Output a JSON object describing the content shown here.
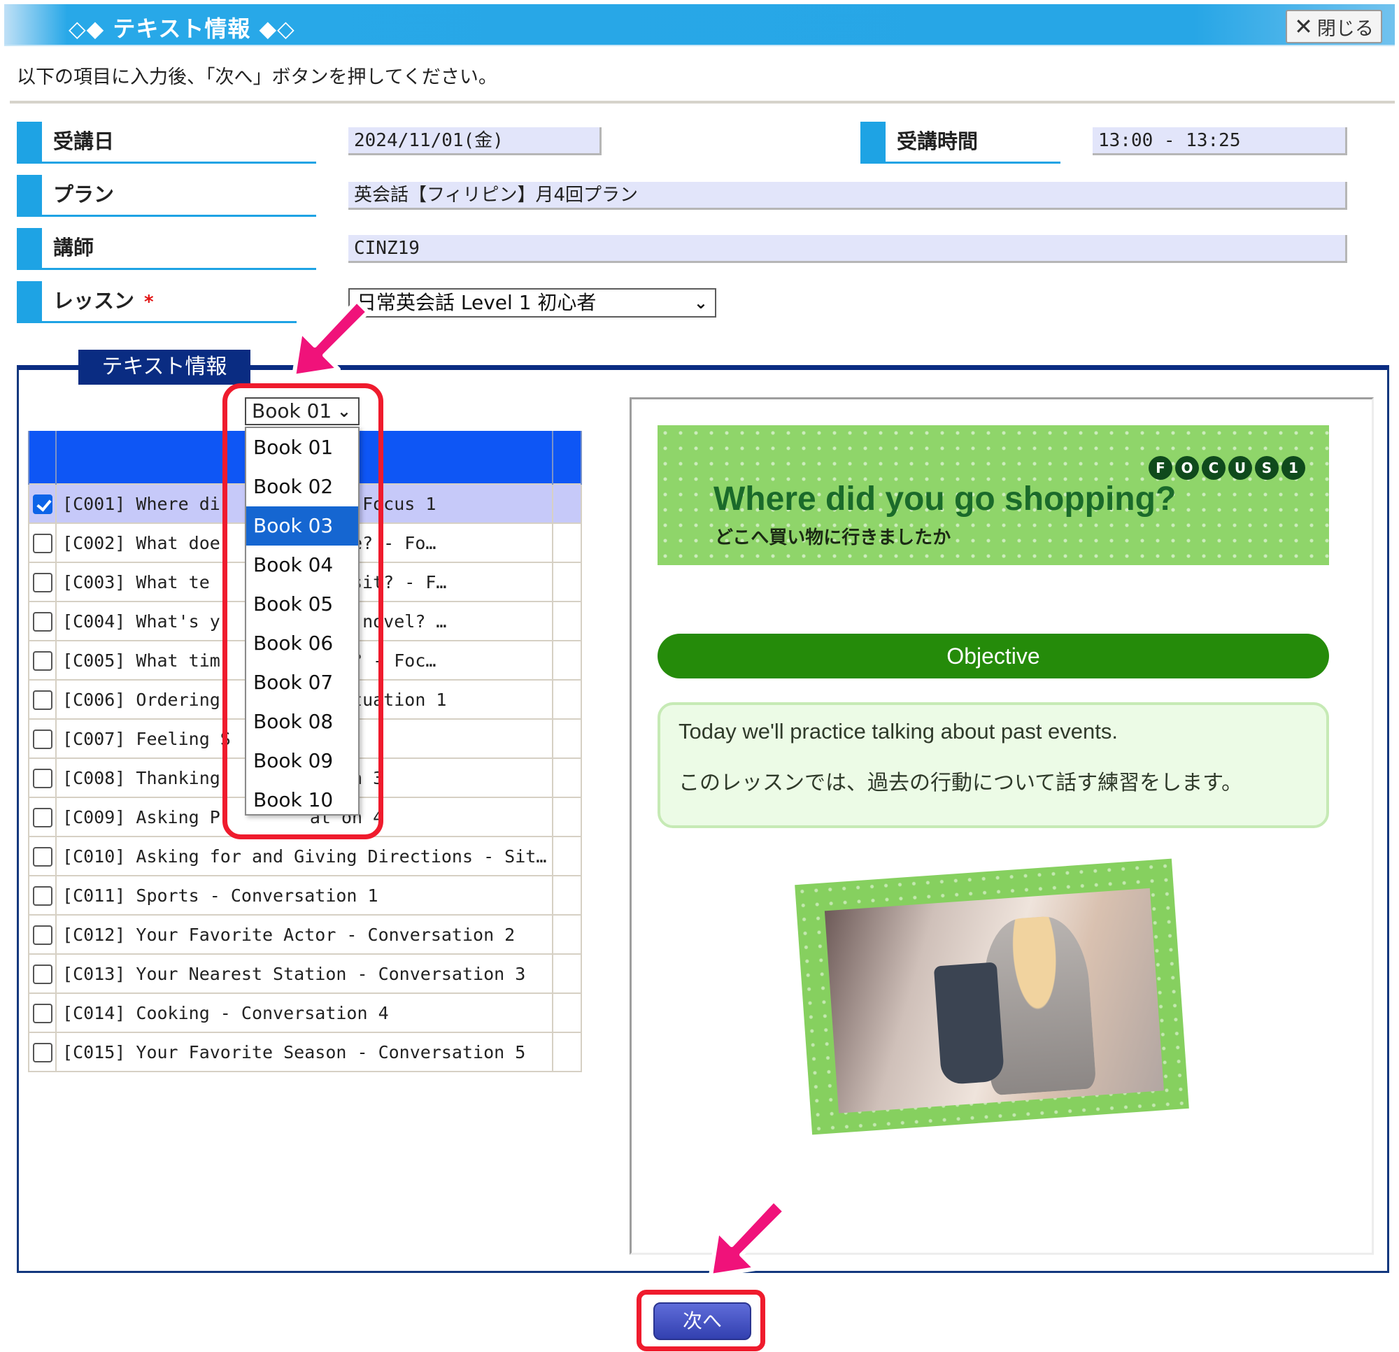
{
  "window": {
    "title": "◇◆ テキスト情報 ◆◇",
    "close_label": "閉じる"
  },
  "instruction": "以下の項目に入力後、「次へ」ボタンを押してください。",
  "fields": {
    "date_label": "受講日",
    "date_value": "2024/11/01(金)",
    "time_label": "受講時間",
    "time_value": "13:00 - 13:25",
    "plan_label": "プラン",
    "plan_value": "英会話【フィリピン】月4回プラン",
    "teacher_label": "講師",
    "teacher_value": "CINZ19",
    "lesson_label": "レッスン",
    "lesson_required": "*",
    "lesson_selected": "日常英会話 Level 1 初心者"
  },
  "text_info": {
    "legend": "テキスト情報",
    "book_selected": "Book 01",
    "book_options": [
      "Book 01",
      "Book 02",
      "Book 03",
      "Book 04",
      "Book 05",
      "Book 06",
      "Book 07",
      "Book 08",
      "Book 09",
      "Book 10"
    ],
    "highlighted_option": "Book 03",
    "lessons": [
      {
        "title": "[C001] Where di",
        "tail": "g? - Focus 1",
        "checked": true
      },
      {
        "title": "[C002] What doe",
        "tail": "k ike? - Fo…",
        "checked": false
      },
      {
        "title": "[C003] What te",
        "tail": "to visit? - F…",
        "checked": false
      },
      {
        "title": "[C004] What's y",
        "tail": "ri e novel? …",
        "checked": false
      },
      {
        "title": "[C005] What tim",
        "tail": "wo k? - Foc…",
        "checked": false
      },
      {
        "title": "[C006] Ordering",
        "tail": "- Situation 1",
        "checked": false
      },
      {
        "title": "[C007] Feeling S",
        "tail": "",
        "checked": false
      },
      {
        "title": "[C008] Thanking",
        "tail": "at on 3",
        "checked": false
      },
      {
        "title": "[C009] Asking P",
        "tail": "at on 4",
        "checked": false
      },
      {
        "title": "[C010] Asking for and Giving Directions - Sit…",
        "tail": "",
        "checked": false
      },
      {
        "title": "[C011] Sports - Conversation 1",
        "tail": "",
        "checked": false
      },
      {
        "title": "[C012] Your Favorite Actor - Conversation 2",
        "tail": "",
        "checked": false
      },
      {
        "title": "[C013] Your Nearest Station - Conversation 3",
        "tail": "",
        "checked": false
      },
      {
        "title": "[C014] Cooking - Conversation 4",
        "tail": "",
        "checked": false
      },
      {
        "title": "[C015] Your Favorite Season - Conversation 5",
        "tail": "",
        "checked": false
      }
    ]
  },
  "preview": {
    "focus_letters": [
      "F",
      "O",
      "C",
      "U",
      "S",
      "1"
    ],
    "banner_title": "Where did you go shopping?",
    "banner_subtitle": "どこへ買い物に行きましたか",
    "objective_label": "Objective",
    "objective_en": "Today we'll practice talking about past events.",
    "objective_ja": "このレッスンでは、過去の行動について話す練習をします。"
  },
  "next_button": "次へ",
  "colors": {
    "accent_blue": "#1ea3e4",
    "table_header": "#0e56f5",
    "highlight_red": "#ef1b2d",
    "arrow_pink": "#f0127a",
    "objective_green": "#258b0a"
  }
}
